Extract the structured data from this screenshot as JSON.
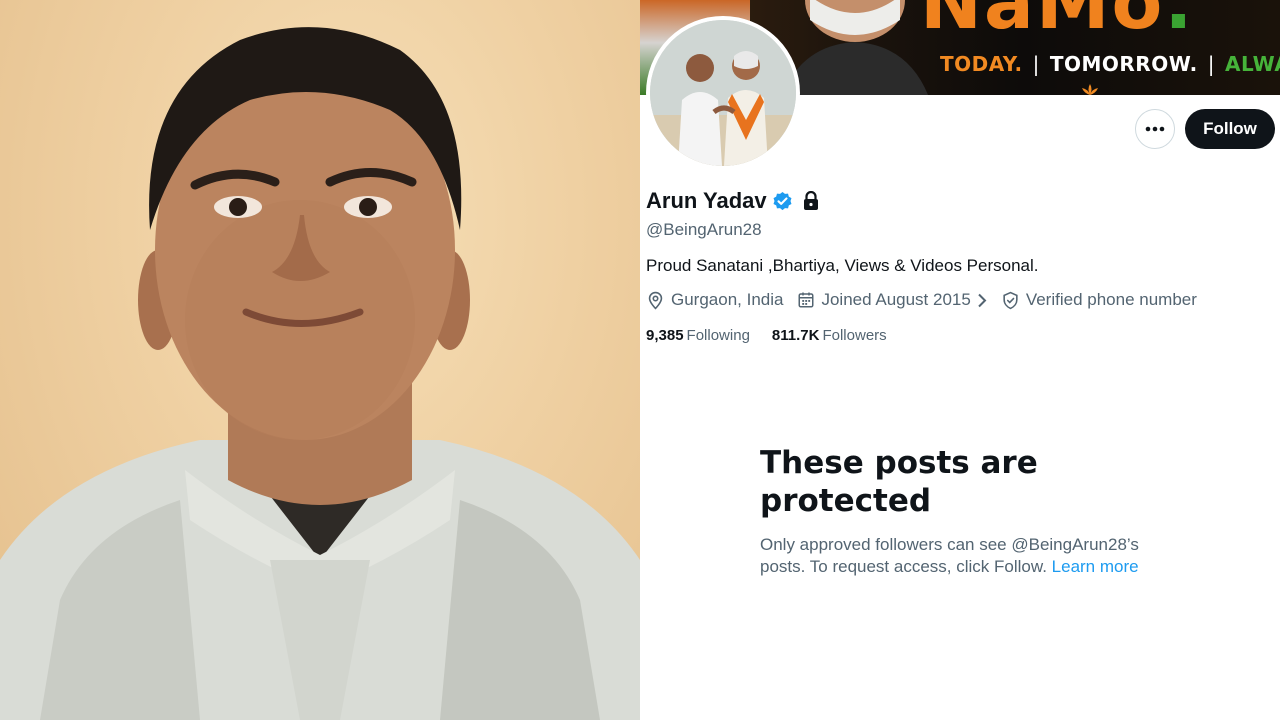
{
  "banner": {
    "slogan_big": "NaMo",
    "slogan_dot": ".",
    "slogan_words": [
      "TODAY.",
      "TOMORROW.",
      "ALWAYS."
    ],
    "separator": "|"
  },
  "profile": {
    "name": "Arun Yadav",
    "handle": "@BeingArun28",
    "bio": "Proud Sanatani ,Bhartiya, Views & Videos Personal.",
    "location": "Gurgaon, India",
    "joined": "Joined August 2015",
    "verified_phone": "Verified phone number",
    "following_count": "9,385",
    "following_label": "Following",
    "followers_count": "811.7K",
    "followers_label": "Followers",
    "follow_button": "Follow"
  },
  "protected_notice": {
    "title": "These posts are protected",
    "body": "Only approved followers can see @BeingArun28’s posts. To request access, click Follow.",
    "link": "Learn more"
  },
  "icons": {
    "more": "more-horizontal-icon",
    "verified": "verified-badge-icon",
    "lock": "lock-icon",
    "location": "location-pin-icon",
    "calendar": "calendar-icon",
    "chevron": "chevron-right-icon",
    "shield": "shield-check-icon"
  },
  "colors": {
    "text_primary": "#0f1419",
    "text_secondary": "#536471",
    "link": "#1d9bf0",
    "follow_button_bg": "#0f1419"
  }
}
